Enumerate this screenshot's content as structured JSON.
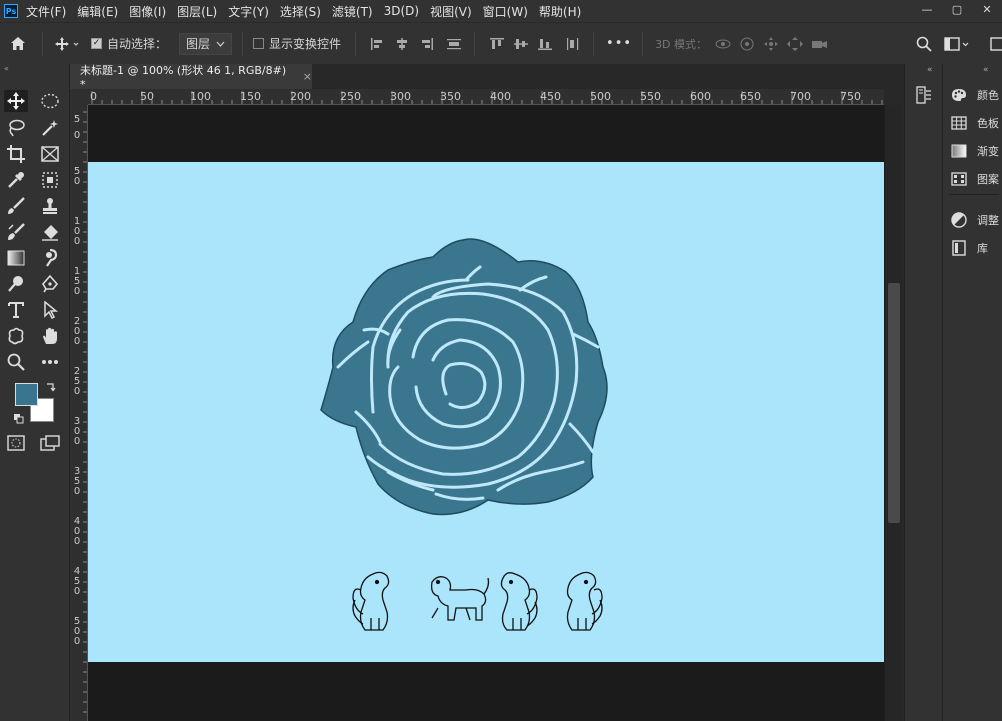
{
  "app": {
    "logo": "Ps"
  },
  "menu": [
    "文件(F)",
    "编辑(E)",
    "图像(I)",
    "图层(L)",
    "文字(Y)",
    "选择(S)",
    "滤镜(T)",
    "3D(D)",
    "视图(V)",
    "窗口(W)",
    "帮助(H)"
  ],
  "window_controls": {
    "minimize": "—",
    "maximize": "▢",
    "close": "✕"
  },
  "options": {
    "auto_select_label": "自动选择：",
    "auto_select_checked": true,
    "layer_dropdown": "图层",
    "show_transform_label": "显示变换控件",
    "more": "•••",
    "mode3d_label": "3D 模式："
  },
  "document": {
    "tab_title": "未标题-1 @ 100% (形状 46 1, RGB/8#) *",
    "tab_close": "×"
  },
  "ruler_h": [
    "0",
    "50",
    "100",
    "150",
    "200",
    "250",
    "300",
    "350",
    "400",
    "450",
    "500",
    "550",
    "600",
    "650",
    "700",
    "750"
  ],
  "ruler_v": [
    "5",
    "0",
    "5 0",
    "1 0 0",
    "1 5 0",
    "2 0 0",
    "2 5 0",
    "3 0 0",
    "3 5 0",
    "4 0 0",
    "4 5 0",
    "5 0 0"
  ],
  "panels": [
    {
      "icon": "color-palette-icon",
      "label": "颜色"
    },
    {
      "icon": "swatches-grid-icon",
      "label": "色板"
    },
    {
      "icon": "gradient-icon",
      "label": "渐变"
    },
    {
      "icon": "pattern-icon",
      "label": "图案"
    },
    {
      "icon": "adjustments-icon",
      "label": "调整"
    },
    {
      "icon": "library-icon",
      "label": "库"
    }
  ],
  "colors": {
    "foreground": "#3a7590",
    "background": "#ffffff",
    "artboard": "#aae5fb",
    "rose": "#3b768f",
    "rose_lines": "#bfe9fa"
  },
  "collapse_glyph": "«"
}
